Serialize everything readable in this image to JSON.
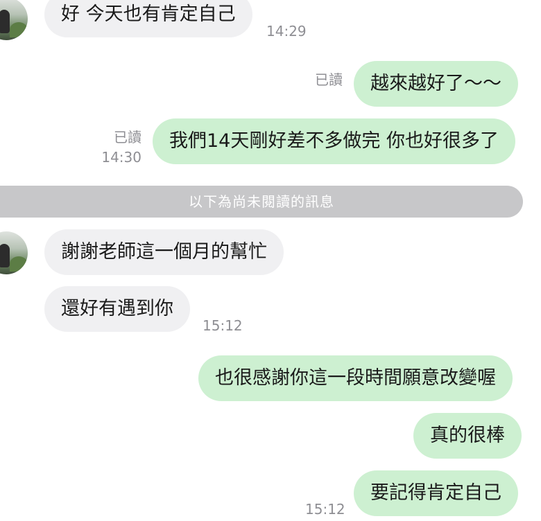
{
  "messages": [
    {
      "text": "好 今天也有肯定自己",
      "time": "14:29"
    },
    {
      "text": "越來越好了～～",
      "read": "已讀"
    },
    {
      "text": "我們14天剛好差不多做完 你也好很多了",
      "read": "已讀",
      "time": "14:30"
    },
    {
      "text": "謝謝老師這一個月的幫忙"
    },
    {
      "text": "還好有遇到你",
      "time": "15:12"
    },
    {
      "text": "也很感謝你這一段時間願意改變喔"
    },
    {
      "text": "真的很棒"
    },
    {
      "text": "要記得肯定自己",
      "time": "15:12"
    }
  ],
  "divider": {
    "label": "以下為尚未閱讀的訊息"
  },
  "colors": {
    "incoming_bubble": "#f0f0f2",
    "outgoing_bubble": "#cdf0d1",
    "divider": "#c7c7c9"
  }
}
